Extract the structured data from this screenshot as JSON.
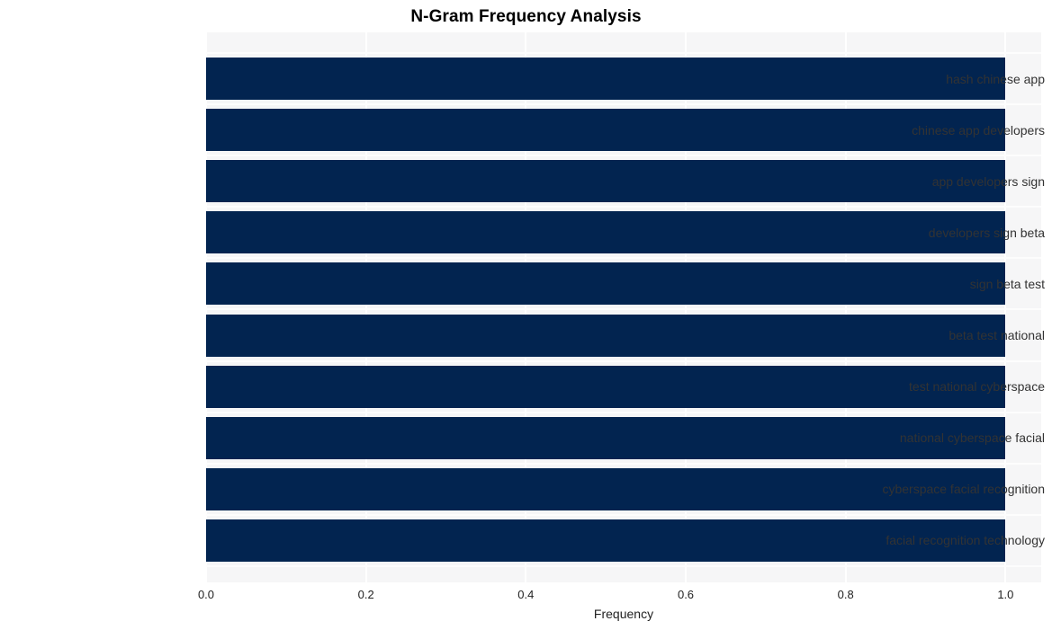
{
  "chart_data": {
    "type": "bar",
    "orientation": "horizontal",
    "title": "N-Gram Frequency Analysis",
    "xlabel": "Frequency",
    "ylabel": "",
    "categories": [
      "hash chinese app",
      "chinese app developers",
      "app developers sign",
      "developers sign beta",
      "sign beta test",
      "beta test national",
      "test national cyberspace",
      "national cyberspace facial",
      "cyberspace facial recognition",
      "facial recognition technology"
    ],
    "values": [
      1.0,
      1.0,
      1.0,
      1.0,
      1.0,
      1.0,
      1.0,
      1.0,
      1.0,
      1.0
    ],
    "xticks": [
      "0.0",
      "0.2",
      "0.4",
      "0.6",
      "0.8",
      "1.0"
    ],
    "xtick_values": [
      0.0,
      0.2,
      0.4,
      0.6,
      0.8,
      1.0
    ],
    "xlim": [
      0.0,
      1.0446
    ],
    "grid": true,
    "legend": null,
    "bar_color": "#022450",
    "plot_background": "#f6f6f7",
    "gridline_color": "#ffffff",
    "title_color": "#000000",
    "tick_label_color": "#333333"
  }
}
